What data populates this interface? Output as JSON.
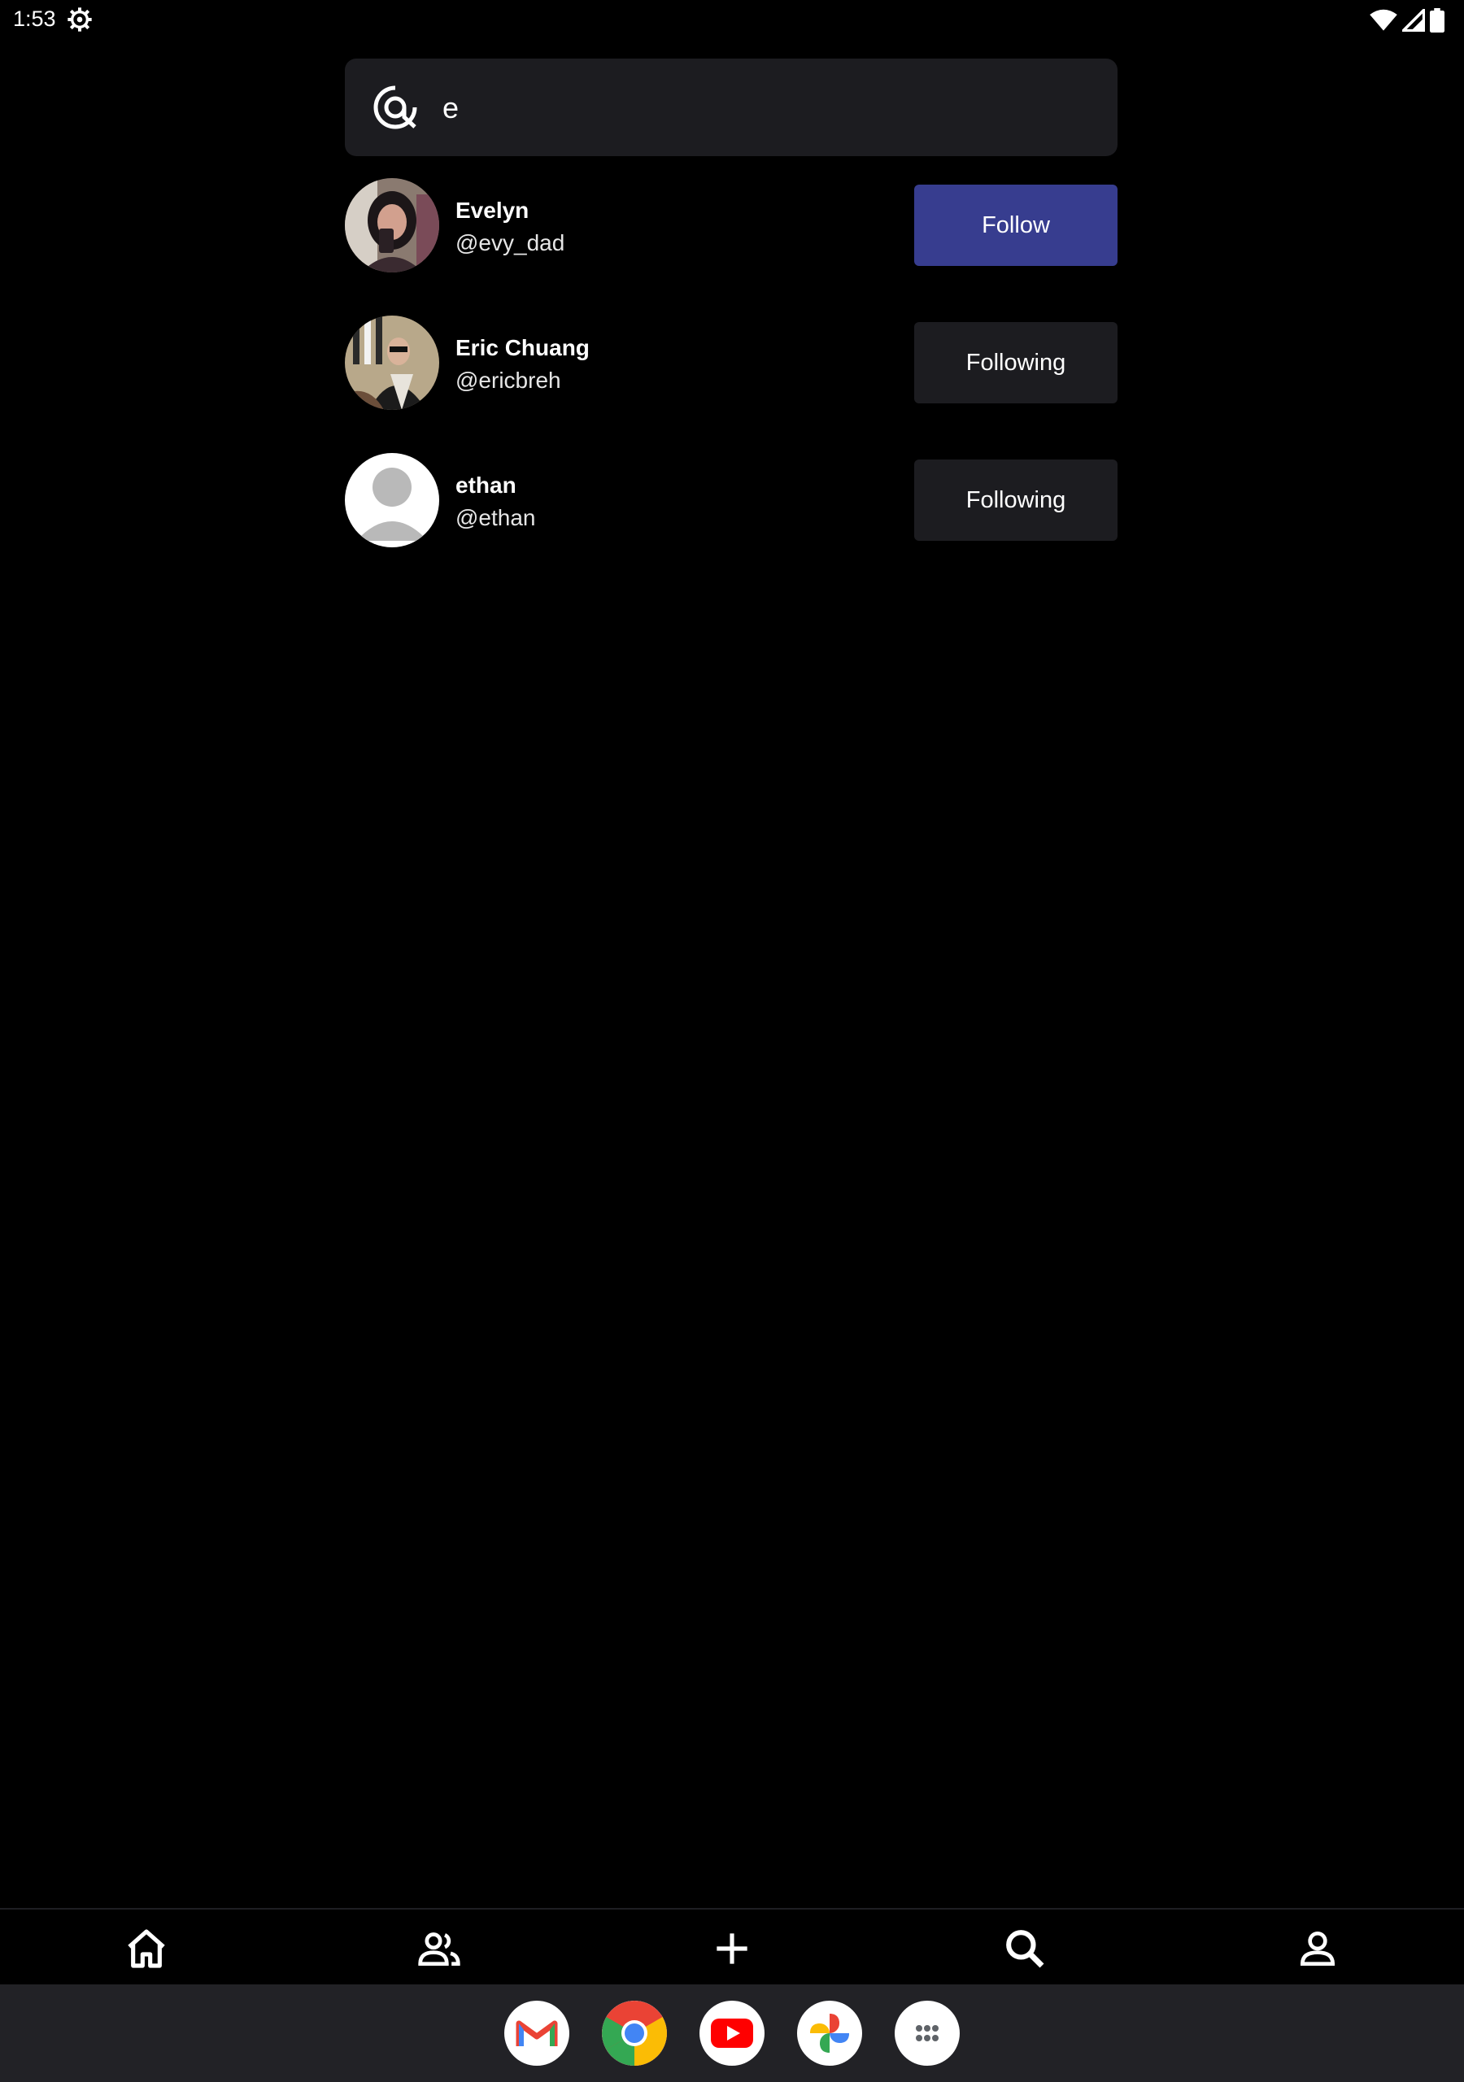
{
  "status": {
    "time": "1:53"
  },
  "search": {
    "value": "e",
    "placeholder": ""
  },
  "users": [
    {
      "name": "Evelyn",
      "handle": "@evy_dad",
      "button": "Follow",
      "state": "not-following"
    },
    {
      "name": "Eric Chuang",
      "handle": "@ericbreh",
      "button": "Following",
      "state": "following"
    },
    {
      "name": "ethan",
      "handle": "@ethan",
      "button": "Following",
      "state": "following"
    }
  ],
  "nav": [
    "home-icon",
    "friends-icon",
    "add-icon",
    "search-icon",
    "profile-icon"
  ],
  "dock": [
    "gmail-icon",
    "chrome-icon",
    "youtube-icon",
    "photos-icon",
    "app-drawer-icon"
  ],
  "colors": {
    "follow_accent": "#373d8f",
    "surface": "#1c1c20",
    "background": "#000000"
  }
}
